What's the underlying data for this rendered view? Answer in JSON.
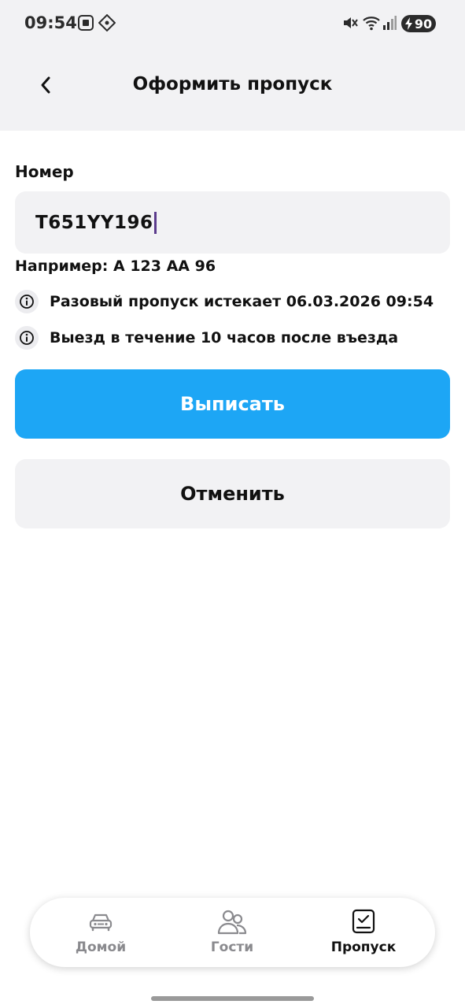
{
  "status_bar": {
    "time": "09:54",
    "battery": "90",
    "icons": [
      "screenshot-icon",
      "app-icon",
      "mute-icon",
      "wifi-icon",
      "signal-icon",
      "battery-charging-icon"
    ]
  },
  "header": {
    "title": "Оформить пропуск",
    "back_icon": "chevron-left-icon"
  },
  "form": {
    "number_label": "Номер",
    "number_value": "T651YY196",
    "example_hint": "Например: А 123 АА 96"
  },
  "info": [
    {
      "icon": "info-icon",
      "text": "Разовый пропуск истекает 06.03.2026 09:54"
    },
    {
      "icon": "info-icon",
      "text": "Выезд в течение 10 часов после въезда"
    }
  ],
  "buttons": {
    "submit_label": "Выписать",
    "cancel_label": "Отменить"
  },
  "bottom_nav": {
    "items": [
      {
        "label": "Домой",
        "icon": "car-icon",
        "active": false
      },
      {
        "label": "Гости",
        "icon": "guests-icon",
        "active": false
      },
      {
        "label": "Пропуск",
        "icon": "pass-icon",
        "active": true
      }
    ]
  },
  "colors": {
    "accent": "#1da6f5",
    "surface": "#f2f2f4",
    "text": "#111111",
    "inactive": "#8a8a8e"
  }
}
